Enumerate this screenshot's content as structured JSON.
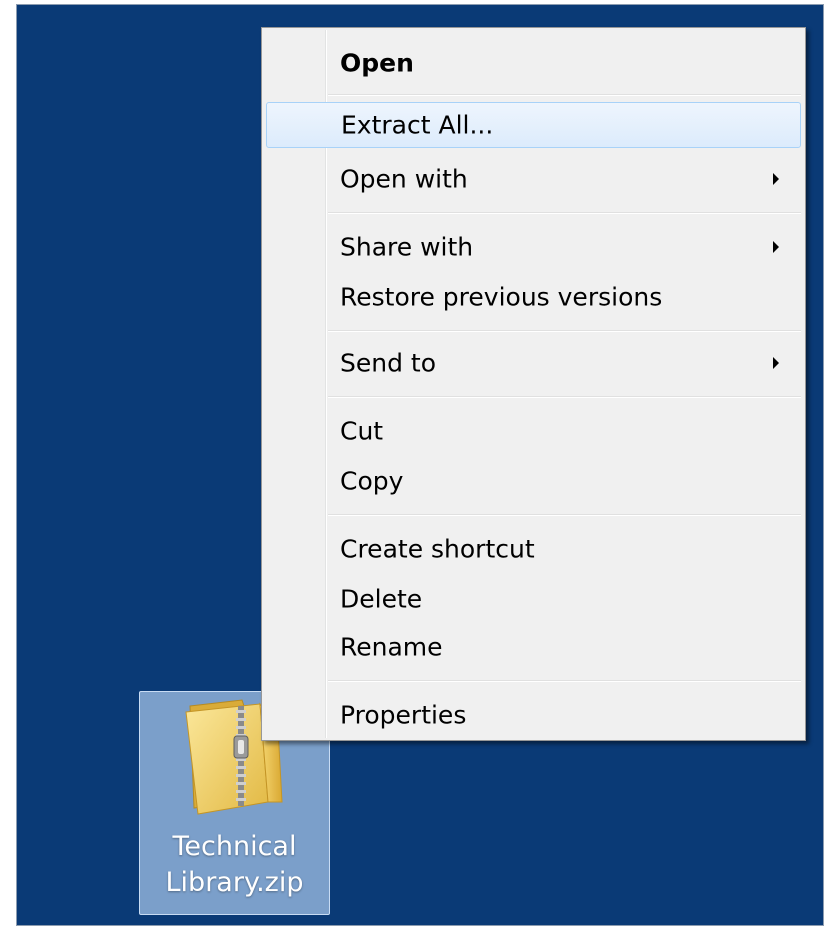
{
  "desktop": {
    "background_color": "#0a3a76",
    "selected_icon": {
      "icon": "zip-folder-icon",
      "name_line1": "Technical",
      "name_line2": "Library.zip"
    }
  },
  "context_menu": {
    "highlight_color": "#dcebfc",
    "items": [
      {
        "label": "Open",
        "bold": true
      },
      {
        "label": "Extract All...",
        "highlighted": true
      },
      {
        "label": "Open with",
        "submenu": true
      },
      {
        "label": "Share with",
        "submenu": true
      },
      {
        "label": "Restore previous versions"
      },
      {
        "label": "Send to",
        "submenu": true
      },
      {
        "label": "Cut"
      },
      {
        "label": "Copy"
      },
      {
        "label": "Create shortcut"
      },
      {
        "label": "Delete"
      },
      {
        "label": "Rename"
      },
      {
        "label": "Properties"
      }
    ]
  }
}
